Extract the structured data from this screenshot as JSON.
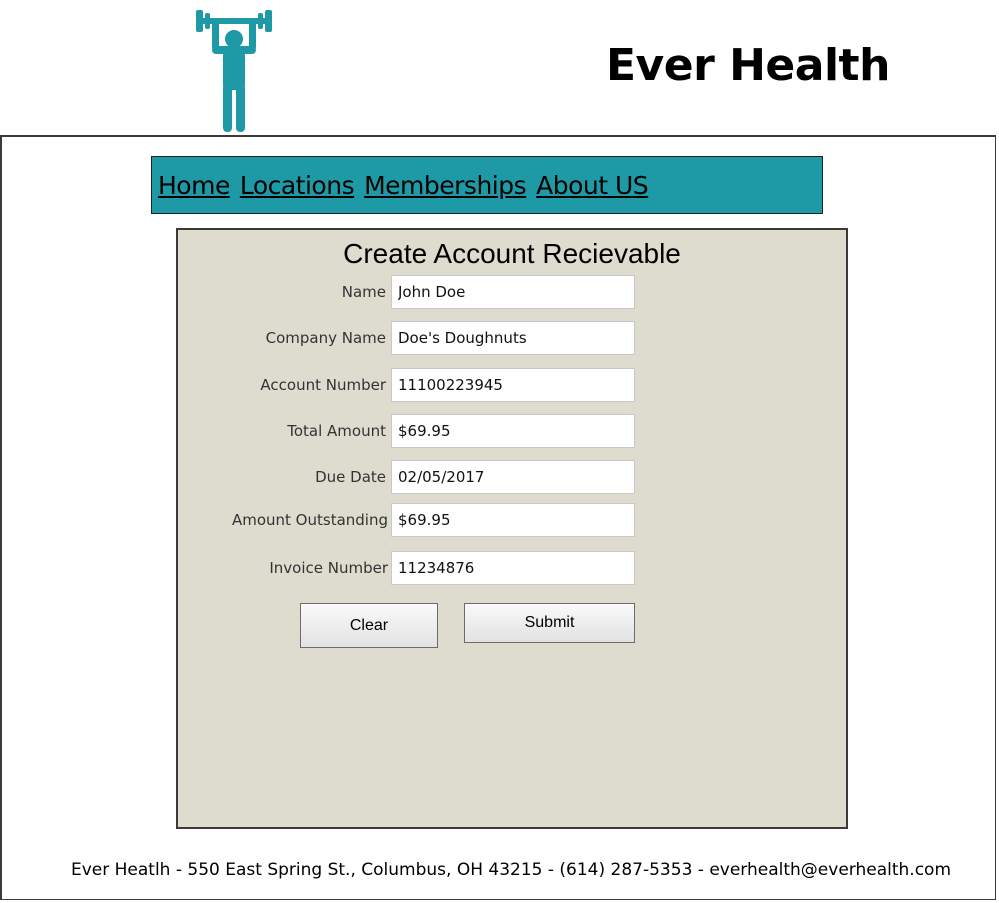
{
  "header": {
    "logo_icon": "weightlifter-icon",
    "brand": "Ever Health",
    "accent_color": "#1e99a6"
  },
  "nav": {
    "items": [
      {
        "label": "Home"
      },
      {
        "label": "Locations"
      },
      {
        "label": "Memberships"
      },
      {
        "label": "About US"
      }
    ]
  },
  "form": {
    "title": "Create Account Recievable",
    "fields": [
      {
        "label": "Name",
        "value": "John Doe"
      },
      {
        "label": "Company Name",
        "value": "Doe's Doughnuts"
      },
      {
        "label": "Account Number",
        "value": "11100223945"
      },
      {
        "label": "Total Amount",
        "value": "$69.95"
      },
      {
        "label": "Due Date",
        "value": "02/05/2017"
      },
      {
        "label": "Amount Outstanding",
        "value": "$69.95"
      },
      {
        "label": "Invoice Number",
        "value": "11234876"
      }
    ],
    "clear_label": "Clear",
    "submit_label": "Submit"
  },
  "footer": {
    "text": "Ever Heatlh - 550 East Spring St., Columbus, OH 43215 - (614) 287-5353 - everhealth@everhealth.com"
  }
}
